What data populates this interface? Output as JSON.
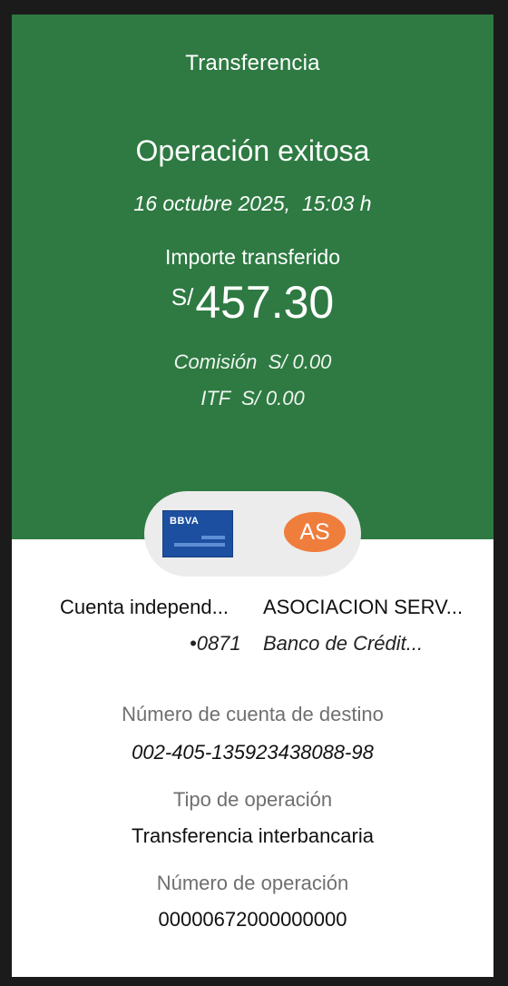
{
  "header": {
    "title": "Transferencia",
    "status": "Operación exitosa",
    "datetime": "16 octubre 2025,  15:03 h",
    "amount_label": "Importe transferido",
    "currency": "S/",
    "amount": "457.30",
    "commission": "Comisión  S/ 0.00",
    "itf": "ITF  S/ 0.00"
  },
  "colors": {
    "header_bg": "#2e7a42",
    "bank_card": "#1c4fa0",
    "avatar": "#ef7d3c"
  },
  "transfer": {
    "origin_bank_logo": "BBVA",
    "recipient_initials": "AS",
    "origin_account": "Cuenta independ...",
    "origin_last_digits": "•0871",
    "recipient_name": "ASOCIACION SERV...",
    "recipient_bank": "Banco de Crédit..."
  },
  "details": {
    "dest_account_label": "Número de cuenta de destino",
    "dest_account_value": "002-405-135923438088-98",
    "op_type_label": "Tipo de operación",
    "op_type_value": "Transferencia interbancaria",
    "op_number_label": "Número de operación",
    "op_number_value": "00000672000000000"
  }
}
